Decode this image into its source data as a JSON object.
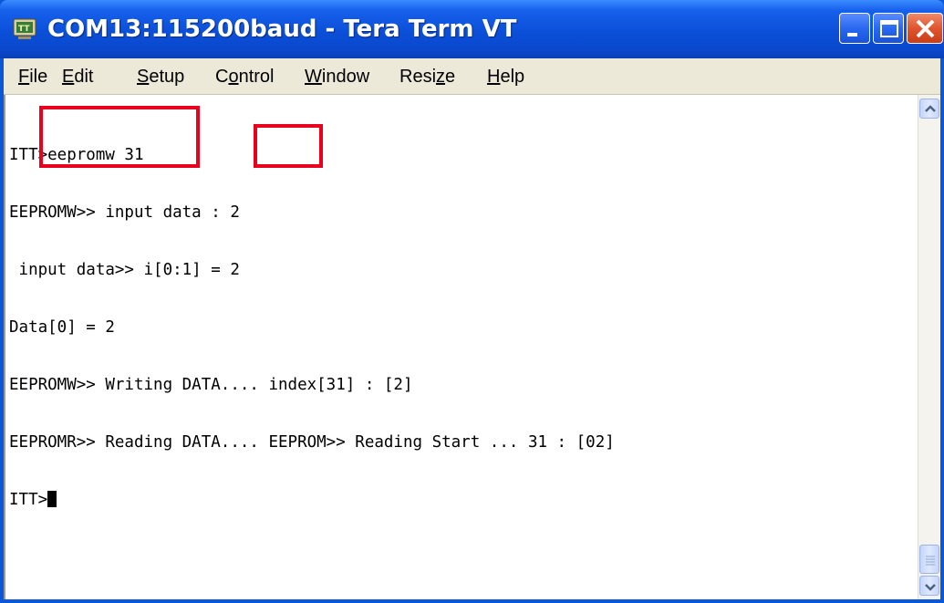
{
  "window": {
    "title": "COM13:115200baud - Tera Term VT",
    "colors": {
      "titlebar": "#0b4fd8",
      "menubar": "#ece9d8",
      "highlight": "#e8001c"
    }
  },
  "menu": {
    "items": [
      {
        "pre": "",
        "u": "F",
        "post": "ile"
      },
      {
        "pre": "",
        "u": "E",
        "post": "dit"
      },
      {
        "pre": "",
        "u": "S",
        "post": "etup"
      },
      {
        "pre": "C",
        "u": "o",
        "post": "ntrol"
      },
      {
        "pre": "",
        "u": "W",
        "post": "indow"
      },
      {
        "pre": "Resi",
        "u": "z",
        "post": "e"
      },
      {
        "pre": "",
        "u": "H",
        "post": "elp"
      }
    ]
  },
  "terminal": {
    "lines": [
      "ITT>eepromw 31",
      "EEPROMW>> input data : 2",
      " input data>> i[0:1] = 2",
      "Data[0] = 2",
      "EEPROMW>> Writing DATA.... index[31] : [2]",
      "EEPROMR>> Reading DATA.... EEPROM>> Reading Start ... 31 : [02]",
      "ITT>"
    ]
  },
  "icons": {
    "app": "tera-term-icon",
    "minimize": "minimize-icon",
    "maximize": "maximize-icon",
    "close": "close-icon",
    "scroll_up": "chevron-up-icon",
    "scroll_down": "chevron-down-icon"
  }
}
